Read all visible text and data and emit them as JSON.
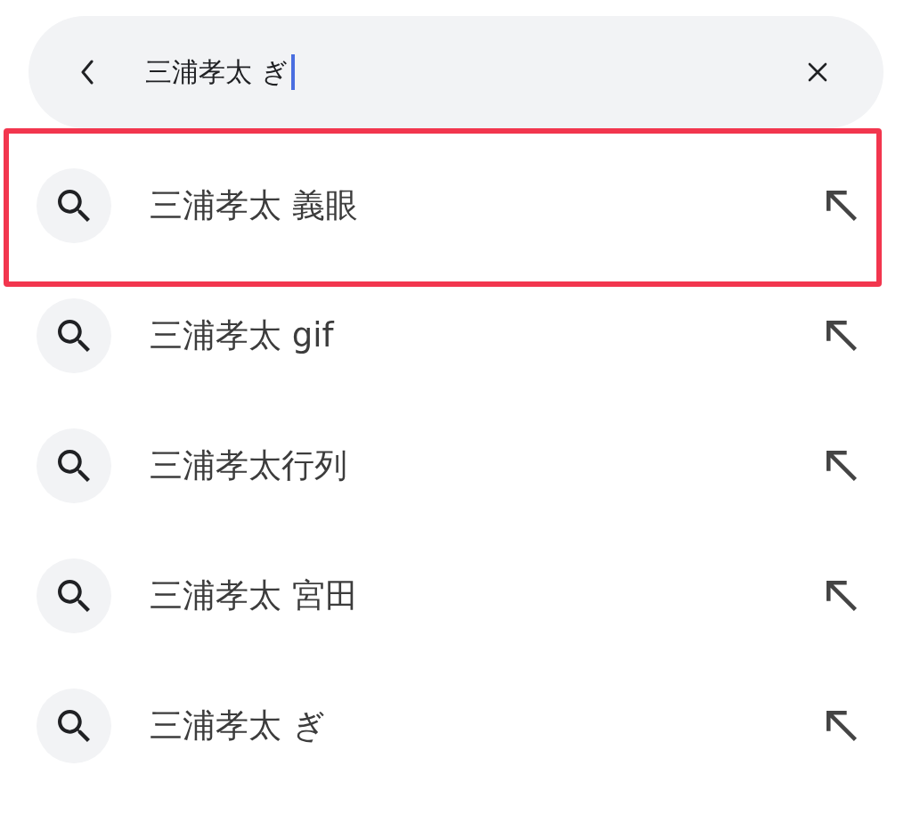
{
  "search_bar": {
    "value": "三浦孝太 ぎ",
    "focused": true
  },
  "suggestions": [
    {
      "text": "三浦孝太 義眼",
      "highlighted": true
    },
    {
      "text": "三浦孝太 gif",
      "highlighted": false
    },
    {
      "text": "三浦孝太行列",
      "highlighted": false
    },
    {
      "text": "三浦孝太 宮田",
      "highlighted": false
    },
    {
      "text": "三浦孝太 ぎ",
      "highlighted": false
    }
  ]
}
